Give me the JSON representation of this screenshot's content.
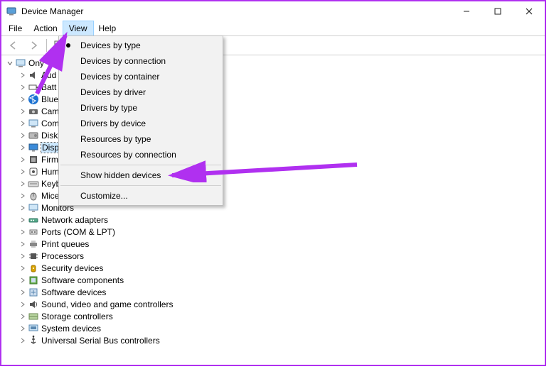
{
  "window": {
    "title": "Device Manager"
  },
  "menubar": {
    "items": [
      "File",
      "Action",
      "View",
      "Help"
    ],
    "highlighted_index": 2
  },
  "dropdown": {
    "items": [
      {
        "label": "Devices by type",
        "selected": true
      },
      {
        "label": "Devices by connection"
      },
      {
        "label": "Devices by container"
      },
      {
        "label": "Devices by driver"
      },
      {
        "label": "Drivers by type"
      },
      {
        "label": "Drivers by device"
      },
      {
        "label": "Resources by type"
      },
      {
        "label": "Resources by connection"
      },
      {
        "sep": true
      },
      {
        "label": "Show hidden devices"
      },
      {
        "sep": true
      },
      {
        "label": "Customize..."
      }
    ]
  },
  "tree": {
    "root": {
      "label_full": "Onyma",
      "label_visible": "Ony",
      "expanded": true
    },
    "children": [
      {
        "icon": "audio-icon",
        "label_visible": "Aud",
        "label_full": "Audio inputs and outputs"
      },
      {
        "icon": "battery-icon",
        "label_visible": "Batt",
        "label_full": "Batteries"
      },
      {
        "icon": "bluetooth-icon",
        "label_visible": "Blue",
        "label_full": "Bluetooth"
      },
      {
        "icon": "camera-icon",
        "label_visible": "Cam",
        "label_full": "Cameras"
      },
      {
        "icon": "computer-icon",
        "label_visible": "Com",
        "label_full": "Computer"
      },
      {
        "icon": "disk-icon",
        "label_visible": "Disk",
        "label_full": "Disk drives"
      },
      {
        "icon": "display-icon",
        "label_visible": "Disp",
        "label_full": "Display adapters",
        "selected": true
      },
      {
        "icon": "firmware-icon",
        "label_visible": "Firm",
        "label_full": "Firmware"
      },
      {
        "icon": "hid-icon",
        "label_visible": "Hum",
        "label_full": "Human Interface Devices"
      },
      {
        "icon": "keyboard-icon",
        "label_visible": "Keyb",
        "label_full": "Keyboards"
      },
      {
        "icon": "mouse-icon",
        "label_visible": "Mice",
        "label_full": "Mice and other pointing devices"
      },
      {
        "icon": "monitor-icon",
        "label_visible": "Monitors",
        "label_full": "Monitors"
      },
      {
        "icon": "network-icon",
        "label_visible": "Network adapters",
        "label_full": "Network adapters"
      },
      {
        "icon": "ports-icon",
        "label_visible": "Ports (COM & LPT)",
        "label_full": "Ports (COM & LPT)"
      },
      {
        "icon": "printer-icon",
        "label_visible": "Print queues",
        "label_full": "Print queues"
      },
      {
        "icon": "cpu-icon",
        "label_visible": "Processors",
        "label_full": "Processors"
      },
      {
        "icon": "security-icon",
        "label_visible": "Security devices",
        "label_full": "Security devices"
      },
      {
        "icon": "softcomp-icon",
        "label_visible": "Software components",
        "label_full": "Software components"
      },
      {
        "icon": "softdev-icon",
        "label_visible": "Software devices",
        "label_full": "Software devices"
      },
      {
        "icon": "sound-icon",
        "label_visible": "Sound, video and game controllers",
        "label_full": "Sound, video and game controllers"
      },
      {
        "icon": "storage-icon",
        "label_visible": "Storage controllers",
        "label_full": "Storage controllers"
      },
      {
        "icon": "system-icon",
        "label_visible": "System devices",
        "label_full": "System devices"
      },
      {
        "icon": "usb-icon",
        "label_visible": "Universal Serial Bus controllers",
        "label_full": "Universal Serial Bus controllers"
      }
    ]
  },
  "annotations": {
    "arrow_color": "#b030f0"
  }
}
